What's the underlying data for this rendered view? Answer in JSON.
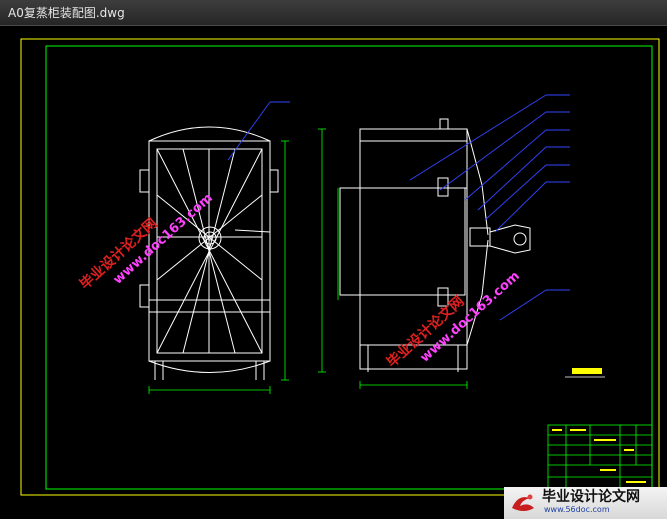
{
  "window": {
    "title": "A0复蒸柜装配图.dwg"
  },
  "watermarks": {
    "main_text": "毕业设计论文网",
    "url_text": "www.doc163.com"
  },
  "footer_logo": {
    "main_text": "毕业设计论文网",
    "url_text": "www.56doc.com",
    "icon": "red-swirl-logo-icon"
  },
  "colors": {
    "background": "#000000",
    "frame": "#ffff00",
    "border": "#00ff00",
    "drawing_lines": "#ffffff",
    "leader_lines": "#3344ff",
    "watermark_main": "#e02020",
    "watermark_url": "#ff40ff"
  }
}
